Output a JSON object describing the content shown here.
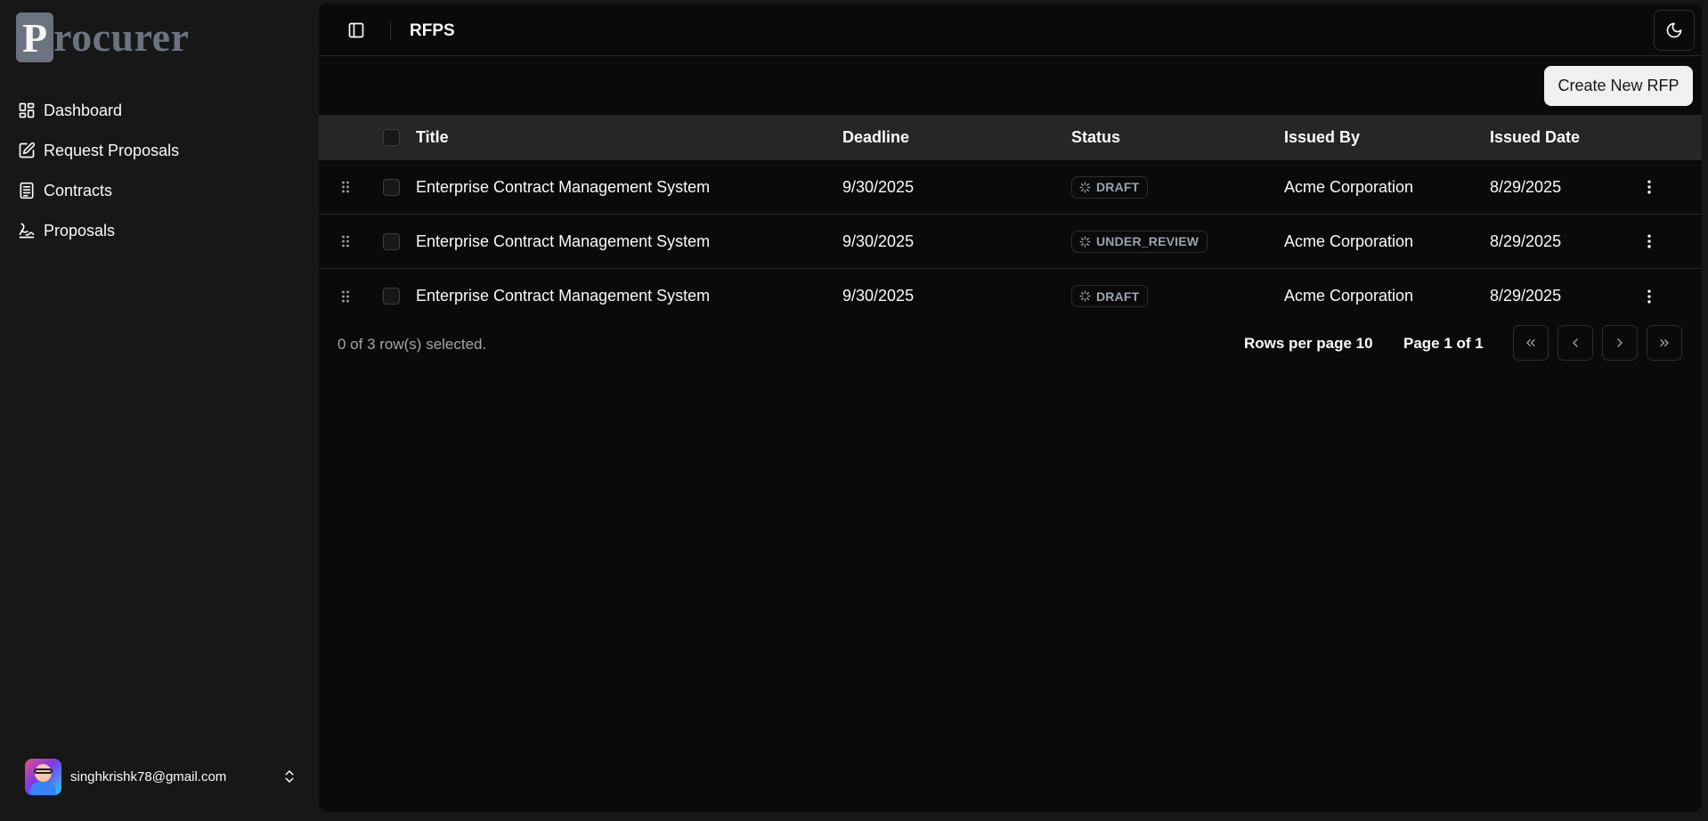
{
  "logo": {
    "initial": "P",
    "rest": "rocurer"
  },
  "sidebar": {
    "items": [
      {
        "label": "Dashboard",
        "icon": "dashboard-icon"
      },
      {
        "label": "Request Proposals",
        "icon": "edit-icon"
      },
      {
        "label": "Contracts",
        "icon": "document-icon"
      },
      {
        "label": "Proposals",
        "icon": "signature-icon"
      }
    ],
    "user": {
      "email": "singhkrishk78@gmail.com"
    }
  },
  "header": {
    "title": "RFPS"
  },
  "actions": {
    "create_label": "Create New RFP"
  },
  "table": {
    "columns": {
      "title": "Title",
      "deadline": "Deadline",
      "status": "Status",
      "issued_by": "Issued By",
      "issued_date": "Issued Date"
    },
    "rows": [
      {
        "title": "Enterprise Contract Management System",
        "deadline": "9/30/2025",
        "status": "DRAFT",
        "issued_by": "Acme Corporation",
        "issued_date": "8/29/2025"
      },
      {
        "title": "Enterprise Contract Management System",
        "deadline": "9/30/2025",
        "status": "UNDER_REVIEW",
        "issued_by": "Acme Corporation",
        "issued_date": "8/29/2025"
      },
      {
        "title": "Enterprise Contract Management System",
        "deadline": "9/30/2025",
        "status": "DRAFT",
        "issued_by": "Acme Corporation",
        "issued_date": "8/29/2025"
      }
    ]
  },
  "pagination": {
    "selected_text": "0 of 3 row(s) selected.",
    "rows_per_page": "Rows per page 10",
    "page_info": "Page 1 of 1"
  },
  "colors": {
    "background": "#0a0a0a",
    "sidebar": "#171717",
    "header_row": "#262626",
    "button": "#f0f0f0",
    "logo": "#6b7280"
  }
}
